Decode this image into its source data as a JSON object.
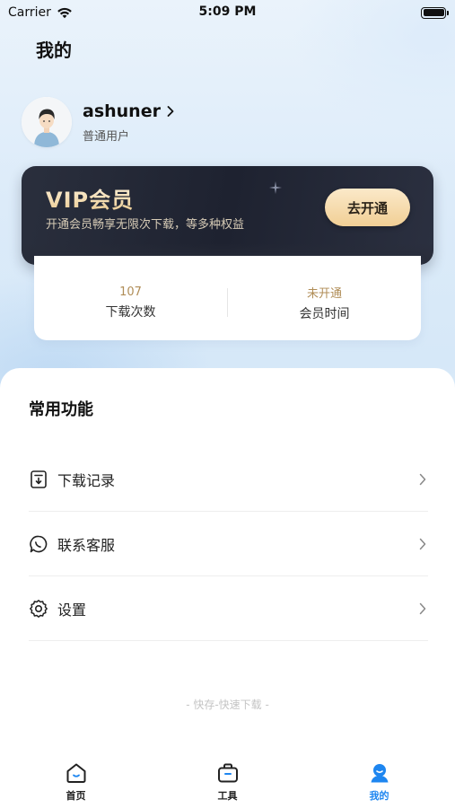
{
  "status_bar": {
    "carrier": "Carrier",
    "time": "5:09 PM"
  },
  "page": {
    "title": "我的"
  },
  "profile": {
    "username": "ashuner",
    "level": "普通用户"
  },
  "vip": {
    "title": "VIP会员",
    "description": "开通会员畅享无限次下载，等多种权益",
    "button_label": "去开通"
  },
  "stats": [
    {
      "value": "107",
      "label": "下载次数"
    },
    {
      "value": "未开通",
      "label": "会员时间"
    }
  ],
  "functions": {
    "title": "常用功能",
    "items": [
      {
        "label": "下载记录",
        "icon": "download-record-icon"
      },
      {
        "label": "联系客服",
        "icon": "chat-icon"
      },
      {
        "label": "设置",
        "icon": "gear-icon"
      }
    ]
  },
  "footer_note": "- 快存-快速下载 -",
  "tab_bar": {
    "tabs": [
      {
        "label": "首页",
        "icon": "home-icon",
        "active": false
      },
      {
        "label": "工具",
        "icon": "toolbox-icon",
        "active": false
      },
      {
        "label": "我的",
        "icon": "profile-icon",
        "active": true
      }
    ]
  },
  "colors": {
    "accent": "#1e86f0",
    "vip_gold": "#f1cf95",
    "vip_dark": "#1e2230",
    "stat_value": "#b08d57"
  }
}
